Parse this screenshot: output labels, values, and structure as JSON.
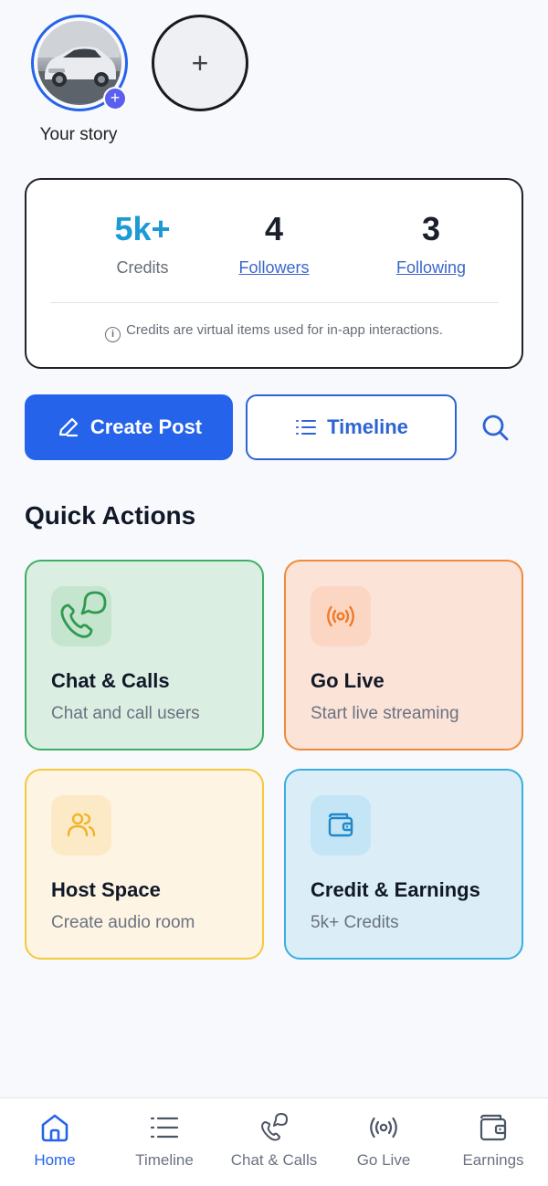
{
  "stories": {
    "own_label": "Your story",
    "add_badge": "+",
    "new_story_symbol": "+"
  },
  "stats": {
    "credits": {
      "value": "5k+",
      "label": "Credits"
    },
    "followers": {
      "value": "4",
      "label": "Followers"
    },
    "following": {
      "value": "3",
      "label": "Following"
    },
    "note": "Credits are virtual items used for in-app interactions.",
    "note_icon": "i"
  },
  "actions": {
    "create_post": "Create Post",
    "timeline": "Timeline"
  },
  "quick_actions": {
    "title": "Quick Actions",
    "items": [
      {
        "title": "Chat & Calls",
        "subtitle": "Chat and call users",
        "icon": "chat-call-icon",
        "color": "#3fae63"
      },
      {
        "title": "Go Live",
        "subtitle": "Start live streaming",
        "icon": "broadcast-icon",
        "color": "#f08a3a"
      },
      {
        "title": "Host Space",
        "subtitle": "Create audio room",
        "icon": "users-icon",
        "color": "#f4c93b"
      },
      {
        "title": "Credit & Earnings",
        "subtitle": "5k+ Credits",
        "icon": "wallet-icon",
        "color": "#3aaedf"
      }
    ]
  },
  "bottom_nav": {
    "items": [
      {
        "label": "Home",
        "icon": "home-icon",
        "active": true
      },
      {
        "label": "Timeline",
        "icon": "list-icon",
        "active": false
      },
      {
        "label": "Chat & Calls",
        "icon": "chat-call-icon",
        "active": false
      },
      {
        "label": "Go Live",
        "icon": "broadcast-icon",
        "active": false
      },
      {
        "label": "Earnings",
        "icon": "wallet-icon",
        "active": false
      }
    ]
  },
  "colors": {
    "primary": "#2563eb",
    "credits_accent": "#1b9ad6",
    "link": "#3b67c9"
  }
}
